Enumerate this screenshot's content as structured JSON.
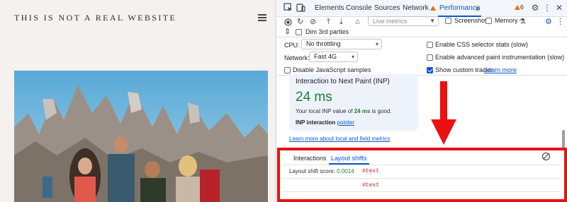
{
  "site": {
    "title": "THIS IS NOT A REAL WEBSITE"
  },
  "devtools": {
    "tabs": [
      {
        "label": "Elements"
      },
      {
        "label": "Console"
      },
      {
        "label": "Sources"
      },
      {
        "label": "Network"
      },
      {
        "label": "Performance"
      }
    ],
    "more_tabs": "»",
    "warning_count": "6",
    "live_metrics_placeholder": "Live metrics",
    "screenshots_label": "Screenshots",
    "memory_label": "Memory",
    "dim_3rd_parties_label": "Dim 3rd parties",
    "cpu_label": "CPU:",
    "cpu_value": "No throttling",
    "network_label": "Network:",
    "network_value": "Fast 4G",
    "disable_js_label": "Disable JavaScript samples",
    "css_selector_label": "Enable CSS selector stats (slow)",
    "paint_label": "Enable advanced paint instrumentation (slow)",
    "custom_tracks_label": "Show custom tracks",
    "learn_more": "Learn more",
    "inp": {
      "title": "Interaction to Next Paint (INP)",
      "value": "24 ms",
      "desc_prefix": "Your local INP value of ",
      "desc_value": "24 ms",
      "desc_suffix": " is good.",
      "interaction_label": "INP interaction",
      "interaction_link": "pointer"
    },
    "learn_more_local": "Learn more about local and field metrics",
    "bottom_tabs": [
      {
        "label": "Interactions"
      },
      {
        "label": "Layout shifts"
      }
    ],
    "layout_shift_label": "Layout shift score: ",
    "layout_shift_value": "0.0014",
    "rows": [
      "#text",
      "#text"
    ]
  },
  "colors": {
    "accent": "#0b57d0",
    "good": "#188038",
    "highlight_red": "#ea1111",
    "warning": "#e8710a"
  }
}
